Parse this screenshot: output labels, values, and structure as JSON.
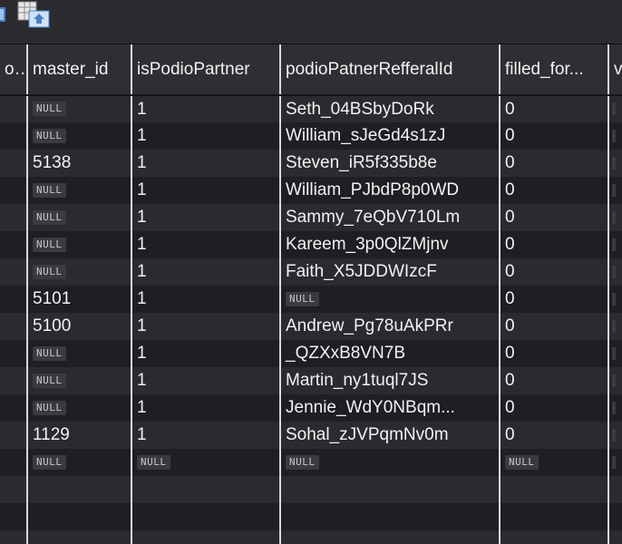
{
  "table": {
    "columns": [
      {
        "id": "col0",
        "label": "o..."
      },
      {
        "id": "master_id",
        "label": "master_id"
      },
      {
        "id": "isPodioPartner",
        "label": "isPodioPartner"
      },
      {
        "id": "podioPatnerRefferalId",
        "label": "podioPatnerRefferalId"
      },
      {
        "id": "filled_for",
        "label": "filled_for..."
      },
      {
        "id": "col5",
        "label": "v"
      }
    ],
    "null_label": "NULL",
    "rows": [
      {
        "master_id": null,
        "isPodioPartner": "1",
        "podioPatnerRefferalId": "Seth_04BSbyDoRk",
        "filled_for": "0"
      },
      {
        "master_id": null,
        "isPodioPartner": "1",
        "podioPatnerRefferalId": "William_sJeGd4s1zJ",
        "filled_for": "0"
      },
      {
        "master_id": "5138",
        "isPodioPartner": "1",
        "podioPatnerRefferalId": "Steven_iR5f335b8e",
        "filled_for": "0"
      },
      {
        "master_id": null,
        "isPodioPartner": "1",
        "podioPatnerRefferalId": "William_PJbdP8p0WD",
        "filled_for": "0"
      },
      {
        "master_id": null,
        "isPodioPartner": "1",
        "podioPatnerRefferalId": "Sammy_7eQbV710Lm",
        "filled_for": "0"
      },
      {
        "master_id": null,
        "isPodioPartner": "1",
        "podioPatnerRefferalId": "Kareem_3p0QlZMjnv",
        "filled_for": "0"
      },
      {
        "master_id": null,
        "isPodioPartner": "1",
        "podioPatnerRefferalId": "Faith_X5JDDWIzcF",
        "filled_for": "0"
      },
      {
        "master_id": "5101",
        "isPodioPartner": "1",
        "podioPatnerRefferalId": null,
        "filled_for": "0"
      },
      {
        "master_id": "5100",
        "isPodioPartner": "1",
        "podioPatnerRefferalId": "Andrew_Pg78uAkPRr",
        "filled_for": "0"
      },
      {
        "master_id": null,
        "isPodioPartner": "1",
        "podioPatnerRefferalId": "_QZXxB8VN7B",
        "filled_for": "0"
      },
      {
        "master_id": null,
        "isPodioPartner": "1",
        "podioPatnerRefferalId": "Martin_ny1tuql7JS",
        "filled_for": "0"
      },
      {
        "master_id": null,
        "isPodioPartner": "1",
        "podioPatnerRefferalId": "Jennie_WdY0NBqm...",
        "filled_for": "0"
      },
      {
        "master_id": "1129",
        "isPodioPartner": "1",
        "podioPatnerRefferalId": "Sohal_zJVPqmNv0m",
        "filled_for": "0"
      },
      {
        "master_id": null,
        "isPodioPartner": null,
        "podioPatnerRefferalId": null,
        "filled_for": null,
        "all_null": true
      }
    ],
    "empty_rows": 3
  },
  "icons": [
    "database-icon",
    "export-icon"
  ],
  "colors": {
    "background": "#1e1e23",
    "row_alt": "#2a2a2f",
    "header": "#2e2e33",
    "grid_line": "#d9d9d9",
    "text": "#f2f2f2",
    "null_badge": "#3a3a3f"
  }
}
